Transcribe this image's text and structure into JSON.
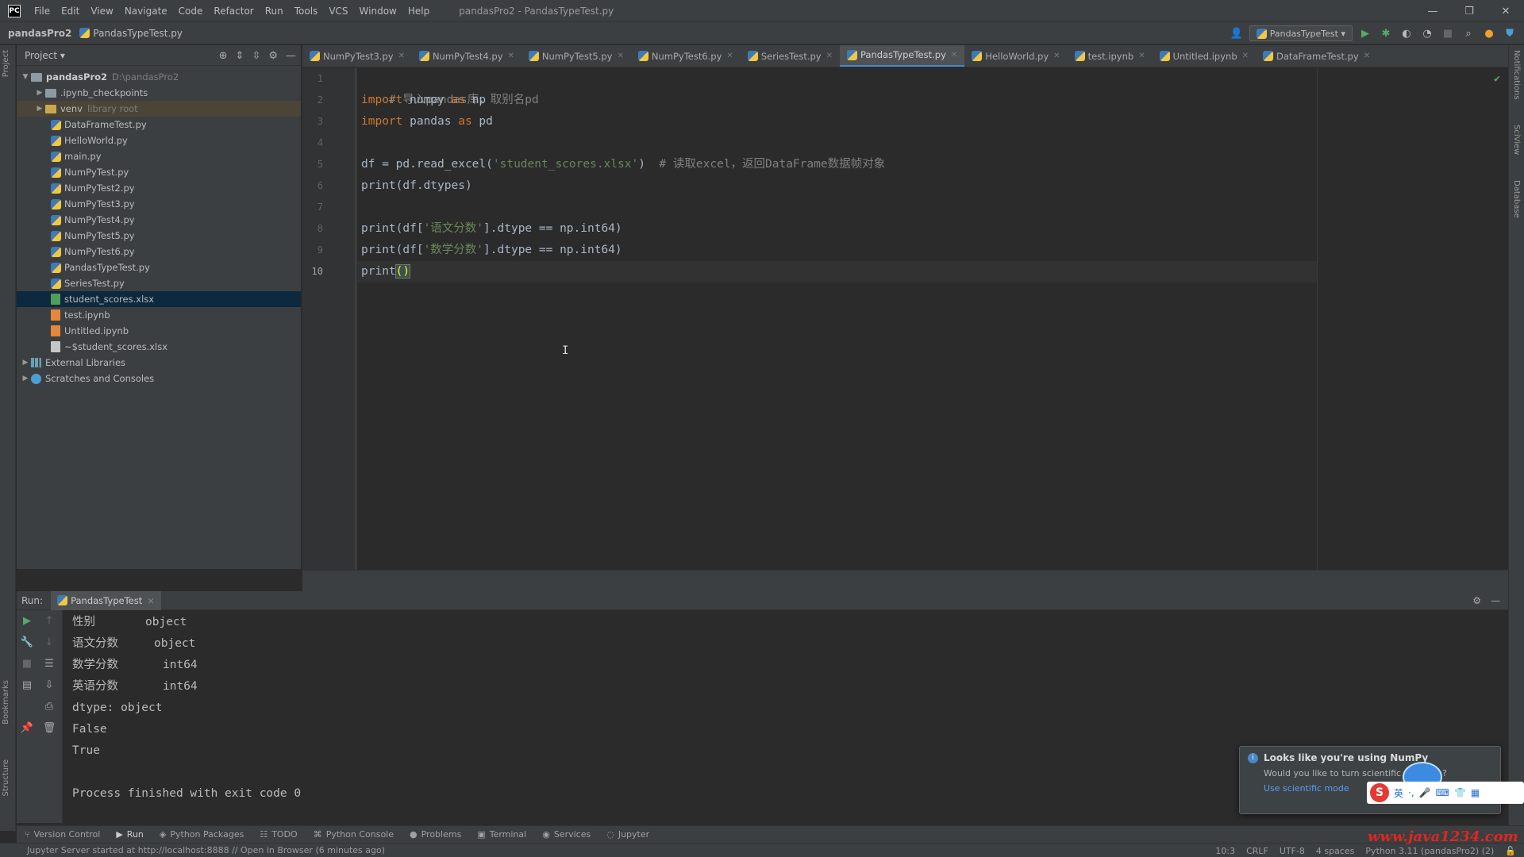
{
  "titlebar": {
    "logo": "PC",
    "menu": [
      "File",
      "Edit",
      "View",
      "Navigate",
      "Code",
      "Refactor",
      "Run",
      "Tools",
      "VCS",
      "Window",
      "Help"
    ],
    "window_title": "pandasPro2 - PandasTypeTest.py",
    "controls": {
      "minimize": "—",
      "restore": "❐",
      "close": "✕"
    }
  },
  "navbar": {
    "project": "pandasPro2",
    "file": "PandasTypeTest.py",
    "run_config": "PandasTypeTest ▾",
    "icons": [
      "user-icon",
      "run-icon",
      "debug-icon",
      "coverage-icon",
      "profile-icon",
      "stop-icon",
      "search-icon",
      "update-icon",
      "shield-icon"
    ]
  },
  "left_strip": {
    "project_tab": "Project",
    "bookmarks_tab": "Bookmarks",
    "structure_tab": "Structure"
  },
  "right_strip": {
    "notifications_tab": "Notifications",
    "sciview_tab": "SciView",
    "database_tab": "Database"
  },
  "project_panel": {
    "title": "Project ▾",
    "tree": {
      "root": {
        "name": "pandasPro2",
        "path": "D:\\pandasPro2"
      },
      "checkpoints": ".ipynb_checkpoints",
      "venv": {
        "name": "venv",
        "hint": "library root"
      },
      "files": [
        "DataFrameTest.py",
        "HelloWorld.py",
        "main.py",
        "NumPyTest.py",
        "NumPyTest2.py",
        "NumPyTest3.py",
        "NumPyTest4.py",
        "NumPyTest5.py",
        "NumPyTest6.py",
        "PandasTypeTest.py",
        "SeriesTest.py"
      ],
      "selected_file": "student_scores.xlsx",
      "files_after": [
        "test.ipynb",
        "Untitled.ipynb",
        "~$student_scores.xlsx"
      ],
      "external": "External Libraries",
      "scratches": "Scratches and Consoles"
    }
  },
  "editor": {
    "tabs": [
      {
        "label": "NumPyTest3.py",
        "active": false
      },
      {
        "label": "NumPyTest4.py",
        "active": false
      },
      {
        "label": "NumPyTest5.py",
        "active": false
      },
      {
        "label": "NumPyTest6.py",
        "active": false
      },
      {
        "label": "SeriesTest.py",
        "active": false
      },
      {
        "label": "PandasTypeTest.py",
        "active": true
      },
      {
        "label": "HelloWorld.py",
        "active": false
      },
      {
        "label": "test.ipynb",
        "active": false
      },
      {
        "label": "Untitled.ipynb",
        "active": false
      },
      {
        "label": "DataFrameTest.py",
        "active": false
      }
    ],
    "line_numbers": [
      "1",
      "2",
      "3",
      "4",
      "5",
      "6",
      "7",
      "8",
      "9",
      "10"
    ],
    "current_line": 10,
    "code": {
      "l1_comment": "# 导入pandas库，取别名pd",
      "l2_kw": "import",
      "l2_mod": " numpy ",
      "l2_as": "as",
      "l2_alias": " np",
      "l3_kw": "import",
      "l3_mod": " pandas ",
      "l3_as": "as",
      "l3_alias": " pd",
      "l5_a": "df = pd.read_excel(",
      "l5_str": "'student_scores.xlsx'",
      "l5_b": ")  ",
      "l5_comment": "# 读取excel，返回DataFrame数据帧对象",
      "l6": "print(df.dtypes)",
      "l8_a": "print(df[",
      "l8_str": "'语文分数'",
      "l8_b": "].dtype == np.int64)",
      "l9_a": "print(df[",
      "l9_str": "'数学分数'",
      "l9_b": "].dtype == np.int64)",
      "l10_a": "print",
      "l10_paren": "()"
    },
    "cursor_glyph": "I",
    "inspection_ok": "✔"
  },
  "run_panel": {
    "label": "Run:",
    "tab": "PandasTypeTest",
    "tab_close": "×",
    "output": [
      {
        "key": "性别",
        "value": "object"
      },
      {
        "key": "语文分数",
        "value": "object"
      },
      {
        "key": "数学分数",
        "value": "int64"
      },
      {
        "key": "英语分数",
        "value": "int64"
      }
    ],
    "dtype_line": "dtype: object",
    "result1": "False",
    "result2": "True",
    "finished": "Process finished with exit code 0"
  },
  "notification": {
    "title": "Looks like you're using NumPy",
    "body": "Would you like to turn scientific mode on?",
    "link": "Use scientific mode"
  },
  "bottom_tools": [
    "Version Control",
    "Run",
    "Python Packages",
    "TODO",
    "Python Console",
    "Problems",
    "Terminal",
    "Services",
    "Jupyter"
  ],
  "status": {
    "message": "Jupyter Server started at http://localhost:8888 // Open in Browser (6 minutes ago)",
    "position": "10:3",
    "line_sep": "CRLF",
    "encoding": "UTF-8",
    "indent": "4 spaces",
    "interpreter": "Python 3.11 (pandasPro2) (2)"
  },
  "watermark": "www.java1234.com",
  "colors": {
    "accent": "#4a88c7",
    "keyword": "#cc7832",
    "string": "#6a8759",
    "comment": "#808080",
    "run_green": "#59a869"
  }
}
